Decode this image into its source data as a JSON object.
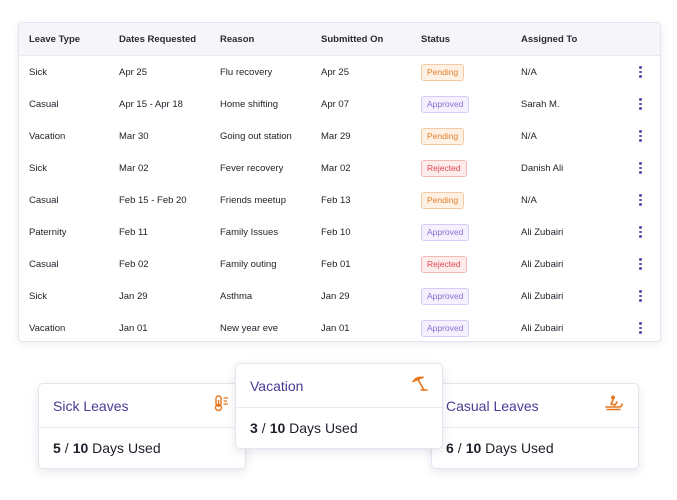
{
  "table": {
    "headers": [
      "Leave Type",
      "Dates Requested",
      "Reason",
      "Submitted On",
      "Status",
      "Assigned To"
    ],
    "rows": [
      {
        "type": "Sick",
        "dates": "Apr 25",
        "reason": "Flu recovery",
        "submitted": "Apr 25",
        "status": "Pending",
        "assigned": "N/A"
      },
      {
        "type": "Casual",
        "dates": "Apr 15 - Apr 18",
        "reason": "Home shifting",
        "submitted": "Apr 07",
        "status": "Approved",
        "assigned": "Sarah M."
      },
      {
        "type": "Vacation",
        "dates": "Mar 30",
        "reason": "Going out station",
        "submitted": "Mar 29",
        "status": "Pending",
        "assigned": "N/A"
      },
      {
        "type": "Sick",
        "dates": "Mar 02",
        "reason": "Fever recovery",
        "submitted": "Mar 02",
        "status": "Rejected",
        "assigned": "Danish Ali"
      },
      {
        "type": "Casual",
        "dates": "Feb 15 - Feb 20",
        "reason": "Friends meetup",
        "submitted": "Feb 13",
        "status": "Pending",
        "assigned": "N/A"
      },
      {
        "type": "Paternity",
        "dates": "Feb 11",
        "reason": "Family Issues",
        "submitted": "Feb 10",
        "status": "Approved",
        "assigned": "Ali Zubairi"
      },
      {
        "type": "Casual",
        "dates": "Feb 02",
        "reason": "Family outing",
        "submitted": "Feb 01",
        "status": "Rejected",
        "assigned": "Ali Zubairi"
      },
      {
        "type": "Sick",
        "dates": "Jan 29",
        "reason": "Asthma",
        "submitted": "Jan 29",
        "status": "Approved",
        "assigned": "Ali Zubairi"
      },
      {
        "type": "Vacation",
        "dates": "Jan 01",
        "reason": "New year eve",
        "submitted": "Jan 01",
        "status": "Approved",
        "assigned": "Ali Zubairi"
      }
    ]
  },
  "cards": {
    "sick": {
      "title": "Sick Leaves",
      "used": "5",
      "slash": "/",
      "total": "10",
      "suffix": "Days Used",
      "icon": "thermometer-icon"
    },
    "vacation": {
      "title": "Vacation",
      "used": "3",
      "slash": "/",
      "total": "10",
      "suffix": "Days Used",
      "icon": "beach-umbrella-icon"
    },
    "casual": {
      "title": "Casual Leaves",
      "used": "6",
      "slash": "/",
      "total": "10",
      "suffix": "Days Used",
      "icon": "sledding-icon"
    }
  },
  "colors": {
    "accent": "#4c3a93",
    "icon": "#e8751a",
    "pending": "#e37f2a",
    "approved": "#8a6fd6",
    "rejected": "#e0474e"
  }
}
